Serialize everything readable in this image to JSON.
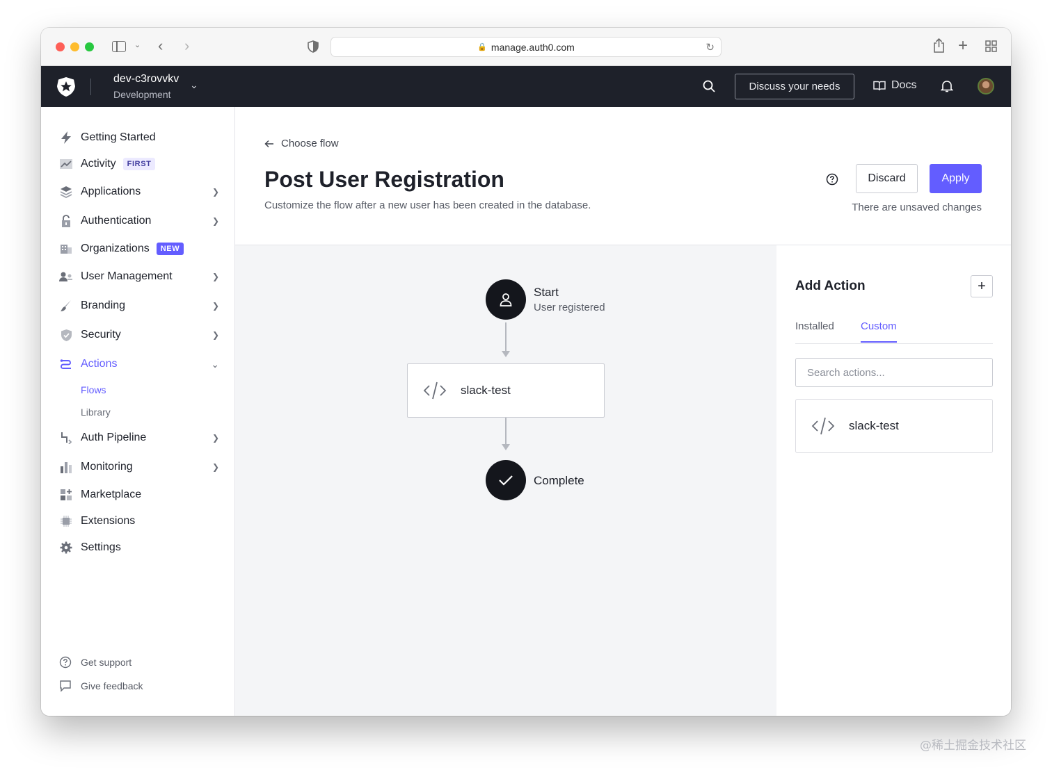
{
  "browser": {
    "url": "manage.auth0.com"
  },
  "header": {
    "tenant_name": "dev-c3rovvkv",
    "tenant_env": "Development",
    "discuss_label": "Discuss your needs",
    "docs_label": "Docs"
  },
  "sidebar": {
    "items": [
      {
        "label": "Getting Started",
        "icon": "bolt-icon"
      },
      {
        "label": "Activity",
        "icon": "chart-icon",
        "badge": "FIRST"
      },
      {
        "label": "Applications",
        "icon": "layers-icon"
      },
      {
        "label": "Authentication",
        "icon": "lock-icon"
      },
      {
        "label": "Organizations",
        "icon": "building-icon",
        "badge": "NEW"
      },
      {
        "label": "User Management",
        "icon": "users-icon"
      },
      {
        "label": "Branding",
        "icon": "brush-icon"
      },
      {
        "label": "Security",
        "icon": "shield-icon"
      },
      {
        "label": "Actions",
        "icon": "actions-icon"
      },
      {
        "label": "Auth Pipeline",
        "icon": "pipeline-icon"
      },
      {
        "label": "Monitoring",
        "icon": "bar-chart-icon"
      },
      {
        "label": "Marketplace",
        "icon": "grid-plus-icon"
      },
      {
        "label": "Extensions",
        "icon": "chip-icon"
      },
      {
        "label": "Settings",
        "icon": "gear-icon"
      }
    ],
    "sub_items": [
      "Flows",
      "Library"
    ],
    "footer": {
      "support": "Get support",
      "feedback": "Give feedback"
    }
  },
  "main": {
    "back_label": "Choose flow",
    "title": "Post User Registration",
    "subtitle": "Customize the flow after a new user has been created in the database.",
    "discard_label": "Discard",
    "apply_label": "Apply",
    "unsaved_text": "There are unsaved changes"
  },
  "flow": {
    "start_title": "Start",
    "start_sub": "User registered",
    "action_label": "slack-test",
    "complete_title": "Complete"
  },
  "panel": {
    "title": "Add Action",
    "tabs": [
      "Installed",
      "Custom"
    ],
    "active_tab": "Custom",
    "search_placeholder": "Search actions...",
    "card_label": "slack-test"
  },
  "colors": {
    "accent": "#635dff",
    "header_bg": "#1e212a",
    "canvas_bg": "#f4f5f7"
  },
  "watermark": "@稀土掘金技术社区"
}
